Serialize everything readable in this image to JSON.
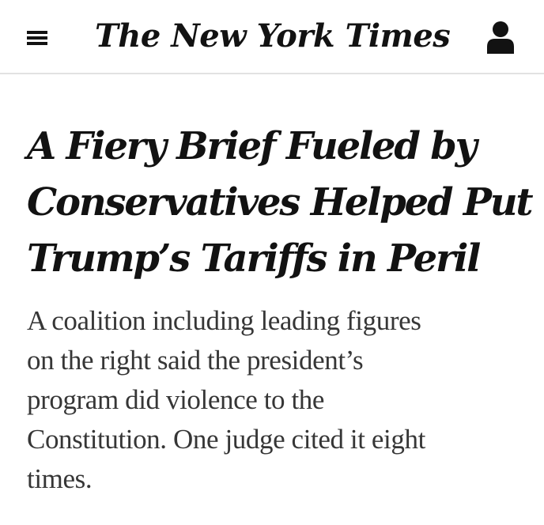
{
  "header": {
    "logo_text": "The New York Times",
    "menu_icon": "hamburger-menu-icon",
    "account_icon": "user-account-icon"
  },
  "article": {
    "headline_lines": [
      "A Fiery Brief Fueled by",
      "Conservatives Helped Put",
      "Trump’s Tariffs in Peril"
    ],
    "summary_lines": [
      "A coalition including leading figures",
      "on the right said the president’s",
      "program did violence to the",
      "Constitution. One judge cited it eight",
      "times."
    ]
  },
  "colors": {
    "headline": "#121212",
    "summary": "#363636",
    "divider": "#e2e2e2",
    "background": "#ffffff"
  }
}
